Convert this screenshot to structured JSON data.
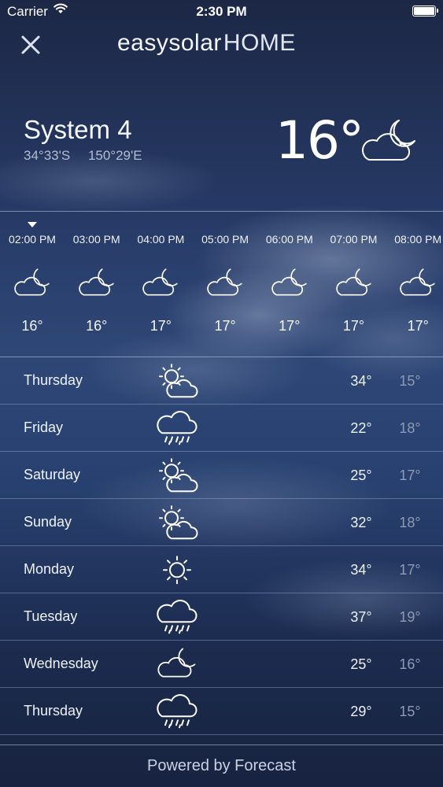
{
  "status_bar": {
    "carrier": "Carrier",
    "time": "2:30 PM"
  },
  "brand": {
    "part1": "easysolar",
    "part2": "HOME"
  },
  "location": {
    "name": "System 4",
    "lat": "34°33'S",
    "lon": "150°29'E"
  },
  "current": {
    "temperature": "16°",
    "icon": "cloud-moon-icon"
  },
  "hourly": [
    {
      "time": "02:00 PM",
      "temp": "16°",
      "icon": "cloud-moon-icon"
    },
    {
      "time": "03:00 PM",
      "temp": "16°",
      "icon": "cloud-moon-icon"
    },
    {
      "time": "04:00 PM",
      "temp": "17°",
      "icon": "cloud-moon-icon"
    },
    {
      "time": "05:00 PM",
      "temp": "17°",
      "icon": "cloud-moon-icon"
    },
    {
      "time": "06:00 PM",
      "temp": "17°",
      "icon": "cloud-moon-icon"
    },
    {
      "time": "07:00 PM",
      "temp": "17°",
      "icon": "cloud-moon-icon"
    },
    {
      "time": "08:00 PM",
      "temp": "17°",
      "icon": "cloud-moon-icon"
    }
  ],
  "daily": [
    {
      "day": "Thursday",
      "high": "34°",
      "low": "15°",
      "icon": "partly-cloudy-sun-icon"
    },
    {
      "day": "Friday",
      "high": "22°",
      "low": "18°",
      "icon": "rain-cloud-icon"
    },
    {
      "day": "Saturday",
      "high": "25°",
      "low": "17°",
      "icon": "partly-cloudy-sun-icon"
    },
    {
      "day": "Sunday",
      "high": "32°",
      "low": "18°",
      "icon": "partly-cloudy-sun-icon"
    },
    {
      "day": "Monday",
      "high": "34°",
      "low": "17°",
      "icon": "sun-icon"
    },
    {
      "day": "Tuesday",
      "high": "37°",
      "low": "19°",
      "icon": "rain-cloud-icon"
    },
    {
      "day": "Wednesday",
      "high": "25°",
      "low": "16°",
      "icon": "cloud-moon-icon"
    },
    {
      "day": "Thursday",
      "high": "29°",
      "low": "15°",
      "icon": "rain-cloud-icon"
    }
  ],
  "footer": {
    "label": "Powered by Forecast"
  },
  "colors": {
    "background_top": "#1c2745",
    "background_mid": "#2f4777",
    "low_temp": "#8f9ab3"
  }
}
